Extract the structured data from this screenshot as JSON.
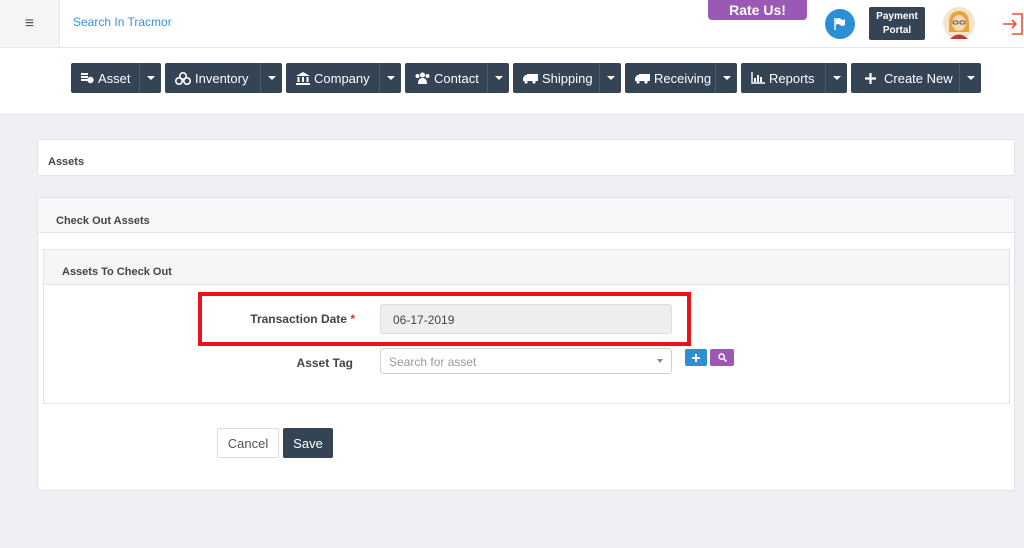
{
  "topbar": {
    "menu_icon": "hamburger-icon",
    "search_link": "Search In Tracmor",
    "rate_us": "Rate Us!",
    "flag_icon": "flag-icon",
    "payment_portal_line1": "Payment",
    "payment_portal_line2": "Portal",
    "avatar_icon": "user-avatar",
    "logout_icon": "logout-icon"
  },
  "nav": {
    "items": [
      {
        "label": "Asset",
        "icon": "asset-icon"
      },
      {
        "label": "Inventory",
        "icon": "inventory-icon"
      },
      {
        "label": "Company",
        "icon": "bank-icon"
      },
      {
        "label": "Contact",
        "icon": "users-icon"
      },
      {
        "label": "Shipping",
        "icon": "truck-icon"
      },
      {
        "label": "Receiving",
        "icon": "truck-icon"
      },
      {
        "label": "Reports",
        "icon": "bar-chart-icon"
      },
      {
        "label": "Create New",
        "icon": "plus-icon"
      }
    ]
  },
  "breadcrumb": {
    "title": "Assets"
  },
  "checkout": {
    "panel_title": "Check Out Assets",
    "section_title": "Assets To Check Out",
    "transaction_date_label": "Transaction Date",
    "required_mark": "*",
    "transaction_date_value": "06-17-2019",
    "asset_tag_label": "Asset Tag",
    "asset_tag_placeholder": "Search for asset",
    "cancel_label": "Cancel",
    "save_label": "Save"
  },
  "colors": {
    "nav_bg": "#344455",
    "rate_us_bg": "#9b59b6",
    "link": "#3a8fd6",
    "highlight": "#e8141b",
    "add_button": "#2b8fd8",
    "search_button": "#9b59b6"
  }
}
